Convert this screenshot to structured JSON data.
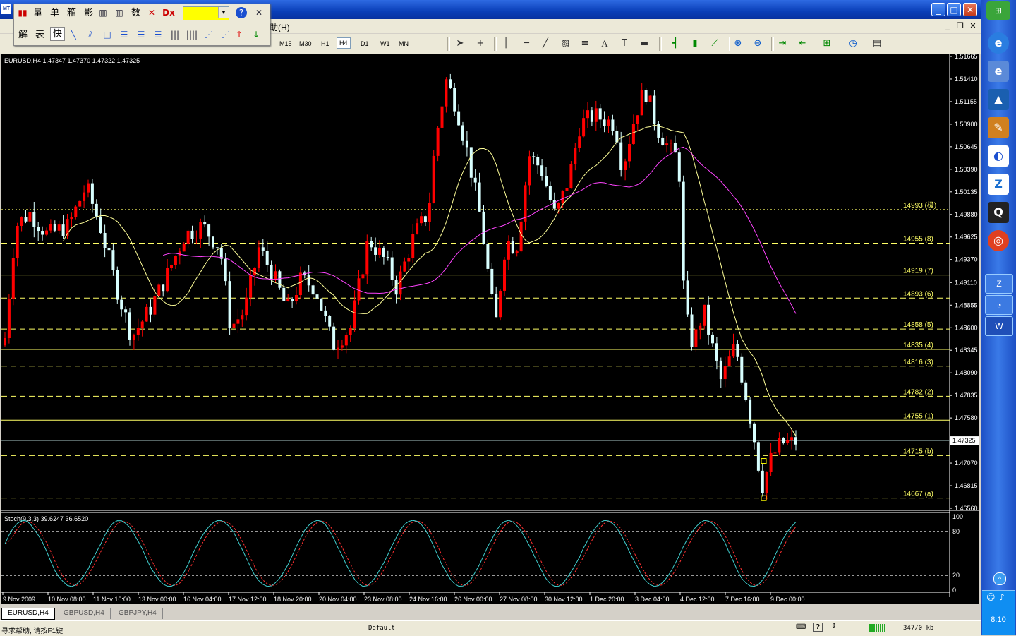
{
  "window": {
    "minimize": "_",
    "maximize": "□",
    "close": "✕",
    "logo": "MT"
  },
  "menu": {
    "help": "助(H)",
    "mdi_min": "_",
    "mdi_restore": "❐",
    "mdi_close": "✕"
  },
  "timeframes": [
    "M15",
    "M30",
    "H1",
    "H4",
    "D1",
    "W1",
    "MN"
  ],
  "active_timeframe": "H4",
  "floatbar": {
    "row1": [
      "量",
      "单",
      "箱",
      "影",
      "数"
    ],
    "row2": [
      "解",
      "表",
      "快"
    ],
    "color": "#ffff00",
    "help": "?",
    "close": "✕"
  },
  "chart": {
    "symbol_info": "EURUSD,H4  1.47347 1.47370 1.47322 1.47325",
    "current_price": "1.47325",
    "indicator_label": "Stoch(9,3,3) 39.6247 36.6520",
    "colors": {
      "bull": "#ff0000",
      "bear": "#d8ffff",
      "fib": "#ffff66",
      "ma_fast": "#ffff99",
      "ma_slow": "#ff44ff",
      "stoch_main": "#40d0d0",
      "stoch_signal": "#ff3030"
    }
  },
  "chart_data": {
    "type": "candlestick",
    "price_axis": [
      "1.51665",
      "1.51410",
      "1.51155",
      "1.50900",
      "1.50645",
      "1.50390",
      "1.50135",
      "1.49880",
      "1.49625",
      "1.49370",
      "1.49110",
      "1.48855",
      "1.48600",
      "1.48345",
      "1.48090",
      "1.47835",
      "1.47580",
      "1.47070",
      "1.46815",
      "1.46560"
    ],
    "ylim": [
      1.4656,
      1.51665
    ],
    "fib_levels": [
      {
        "price": 1.49935,
        "label": "14993 (极)"
      },
      {
        "price": 1.49555,
        "label": "14955 (8)"
      },
      {
        "price": 1.49195,
        "label": "14919 (7)"
      },
      {
        "price": 1.48935,
        "label": "14893 (6)"
      },
      {
        "price": 1.48585,
        "label": "14858 (5)"
      },
      {
        "price": 1.48355,
        "label": "14835 (4)"
      },
      {
        "price": 1.48165,
        "label": "14816 (3)"
      },
      {
        "price": 1.47825,
        "label": "14782 (2)"
      },
      {
        "price": 1.47555,
        "label": "14755 (1)"
      },
      {
        "price": 1.47155,
        "label": "14715 (b)"
      },
      {
        "price": 1.46675,
        "label": "14667 (a)"
      }
    ],
    "time_labels": [
      "9 Nov 2009",
      "10 Nov 08:00",
      "11 Nov 16:00",
      "13 Nov 00:00",
      "16 Nov 04:00",
      "17 Nov 12:00",
      "18 Nov 20:00",
      "20 Nov 04:00",
      "23 Nov 08:00",
      "24 Nov 16:00",
      "26 Nov 00:00",
      "27 Nov 08:00",
      "30 Nov 12:00",
      "1 Dec 20:00",
      "3 Dec 04:00",
      "4 Dec 12:00",
      "7 Dec 16:00",
      "9 Dec 00:00"
    ],
    "stoch_axis": [
      "100",
      "80",
      "20",
      "0"
    ],
    "stoch_ylim": [
      0,
      100
    ]
  },
  "tabs": [
    "EURUSD,H4",
    "GBPUSD,H4",
    "GBPJPY,H4"
  ],
  "status": {
    "help": "寻求帮助, 请按F1键",
    "profile": "Default",
    "traffic": "347/0 kb",
    "help_icon": "?"
  },
  "taskbar": {
    "time": "8:10",
    "icons": [
      "e",
      "e",
      "S",
      "Z",
      "Q"
    ]
  }
}
